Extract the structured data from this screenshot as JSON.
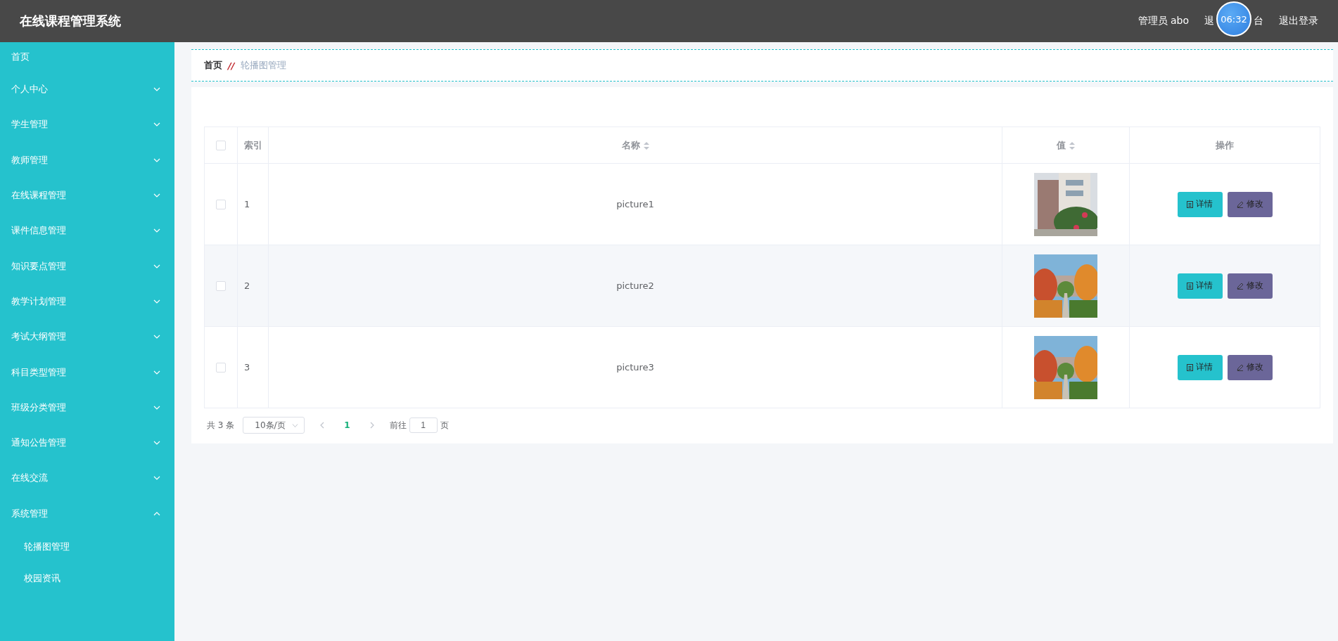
{
  "header": {
    "title": "在线课程管理系统",
    "user": "管理员 abo",
    "front_link": {
      "start": "退",
      "end": "台"
    },
    "logout": "退出登录",
    "timer": "06:32"
  },
  "sidebar": {
    "items": [
      {
        "label": "首页"
      },
      {
        "label": "个人中心",
        "expanded": false
      },
      {
        "label": "学生管理",
        "expanded": false
      },
      {
        "label": "教师管理",
        "expanded": false
      },
      {
        "label": "在线课程管理",
        "expanded": false
      },
      {
        "label": "课件信息管理",
        "expanded": false
      },
      {
        "label": "知识要点管理",
        "expanded": false
      },
      {
        "label": "教学计划管理",
        "expanded": false
      },
      {
        "label": "考试大纲管理",
        "expanded": false
      },
      {
        "label": "科目类型管理",
        "expanded": false
      },
      {
        "label": "班级分类管理",
        "expanded": false
      },
      {
        "label": "通知公告管理",
        "expanded": false
      },
      {
        "label": "在线交流",
        "expanded": false
      },
      {
        "label": "系统管理",
        "expanded": true,
        "children": [
          {
            "label": "轮播图管理"
          },
          {
            "label": "校园资讯"
          }
        ]
      }
    ]
  },
  "breadcrumb": {
    "home": "首页",
    "separator": "//",
    "current": "轮播图管理"
  },
  "table": {
    "columns": [
      {
        "label": "索引",
        "sortable": false
      },
      {
        "label": "名称",
        "sortable": true
      },
      {
        "label": "值",
        "sortable": true
      },
      {
        "label": "操作",
        "sortable": false
      }
    ],
    "rows": [
      {
        "checked": false,
        "index": "1",
        "name": "picture1",
        "value": {
          "kind": "picture"
        },
        "actions": [
          "详情",
          "修改"
        ]
      },
      {
        "checked": false,
        "index": "2",
        "name": "picture2",
        "value": {
          "kind": "picture"
        },
        "actions": [
          "详情",
          "修改"
        ]
      },
      {
        "checked": false,
        "index": "3",
        "name": "picture3",
        "value": {
          "kind": "picture"
        },
        "actions": [
          "详情",
          "修改"
        ]
      }
    ],
    "all_checked": false
  },
  "pagination": {
    "total": "共 3 条",
    "page_size": "10条/页",
    "pages": [
      {
        "label": "1",
        "selected": true
      }
    ],
    "goto_label": "前往",
    "goto_value": "1",
    "goto_suffix": "页"
  }
}
